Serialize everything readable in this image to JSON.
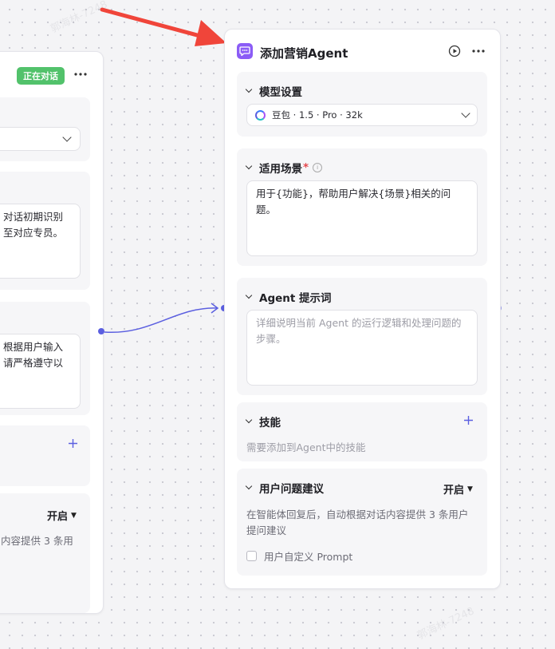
{
  "left_node": {
    "status_badge": "正在对话",
    "scenario_text_line1": "对话初期识别",
    "scenario_text_line2": "至对应专员。",
    "prompt_text_line1": "根据用户输入",
    "prompt_text_line2": "请严格遵守以",
    "suggest_toggle": "开启",
    "suggest_desc": "内容提供 3 条用"
  },
  "right_node": {
    "title": "添加营销Agent",
    "model_section": {
      "title": "模型设置",
      "selected_model": "豆包 · 1.5 · Pro · 32k"
    },
    "scenario_section": {
      "title": "适用场景",
      "required_mark": "*",
      "value": "用于{功能}，帮助用户解决{场景}相关的问题。"
    },
    "prompt_section": {
      "title": "Agent 提示词",
      "placeholder": "详细说明当前 Agent 的运行逻辑和处理问题的步骤。"
    },
    "skills_section": {
      "title": "技能",
      "hint": "需要添加到Agent中的技能"
    },
    "suggest_section": {
      "title": "用户问题建议",
      "toggle_label": "开启",
      "description": "在智能体回复后，自动根据对话内容提供 3 条用户提问建议",
      "custom_prompt_label": "用户自定义 Prompt"
    }
  },
  "colors": {
    "accent": "#5b5fe0",
    "badge_green": "#52c26b",
    "arrow_red": "#f0453a",
    "title_icon": "#8b5cf6"
  },
  "icons": [
    "chat-bubble-icon",
    "play-icon",
    "more-icon",
    "chevron-down-icon",
    "info-icon",
    "plus-icon",
    "doubao-logo-icon",
    "checkbox-icon"
  ]
}
